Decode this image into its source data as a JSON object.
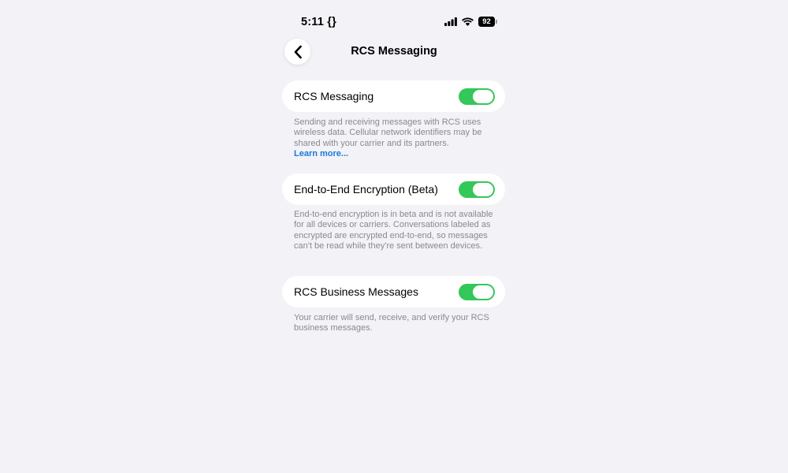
{
  "status_bar": {
    "time": "5:11",
    "focus_indicator": "{}",
    "battery_level": "92",
    "icons": [
      "signal-icon",
      "wifi-icon",
      "battery-icon"
    ]
  },
  "nav": {
    "back_icon": "chevron-left-icon",
    "title": "RCS Messaging"
  },
  "settings": [
    {
      "label": "RCS Messaging",
      "enabled": true,
      "footnote": "Sending and receiving messages with RCS uses wireless data. Cellular network identifiers may be shared with your carrier and its partners.",
      "link": "Learn more..."
    },
    {
      "label": "End-to-End Encryption (Beta)",
      "enabled": true,
      "footnote": "End-to-end encryption is in beta and is not available for all devices or carriers. Conversations labeled as encrypted are encrypted end-to-end, so messages can't be read while they're sent between devices."
    },
    {
      "label": "RCS Business Messages",
      "enabled": true,
      "footnote": "Your carrier will send, receive, and verify your RCS business messages."
    }
  ],
  "colors": {
    "background": "#f2f2f7",
    "toggle_on": "#34c759",
    "link": "#1a7ad9",
    "footnote_text": "#8a8a8e"
  }
}
